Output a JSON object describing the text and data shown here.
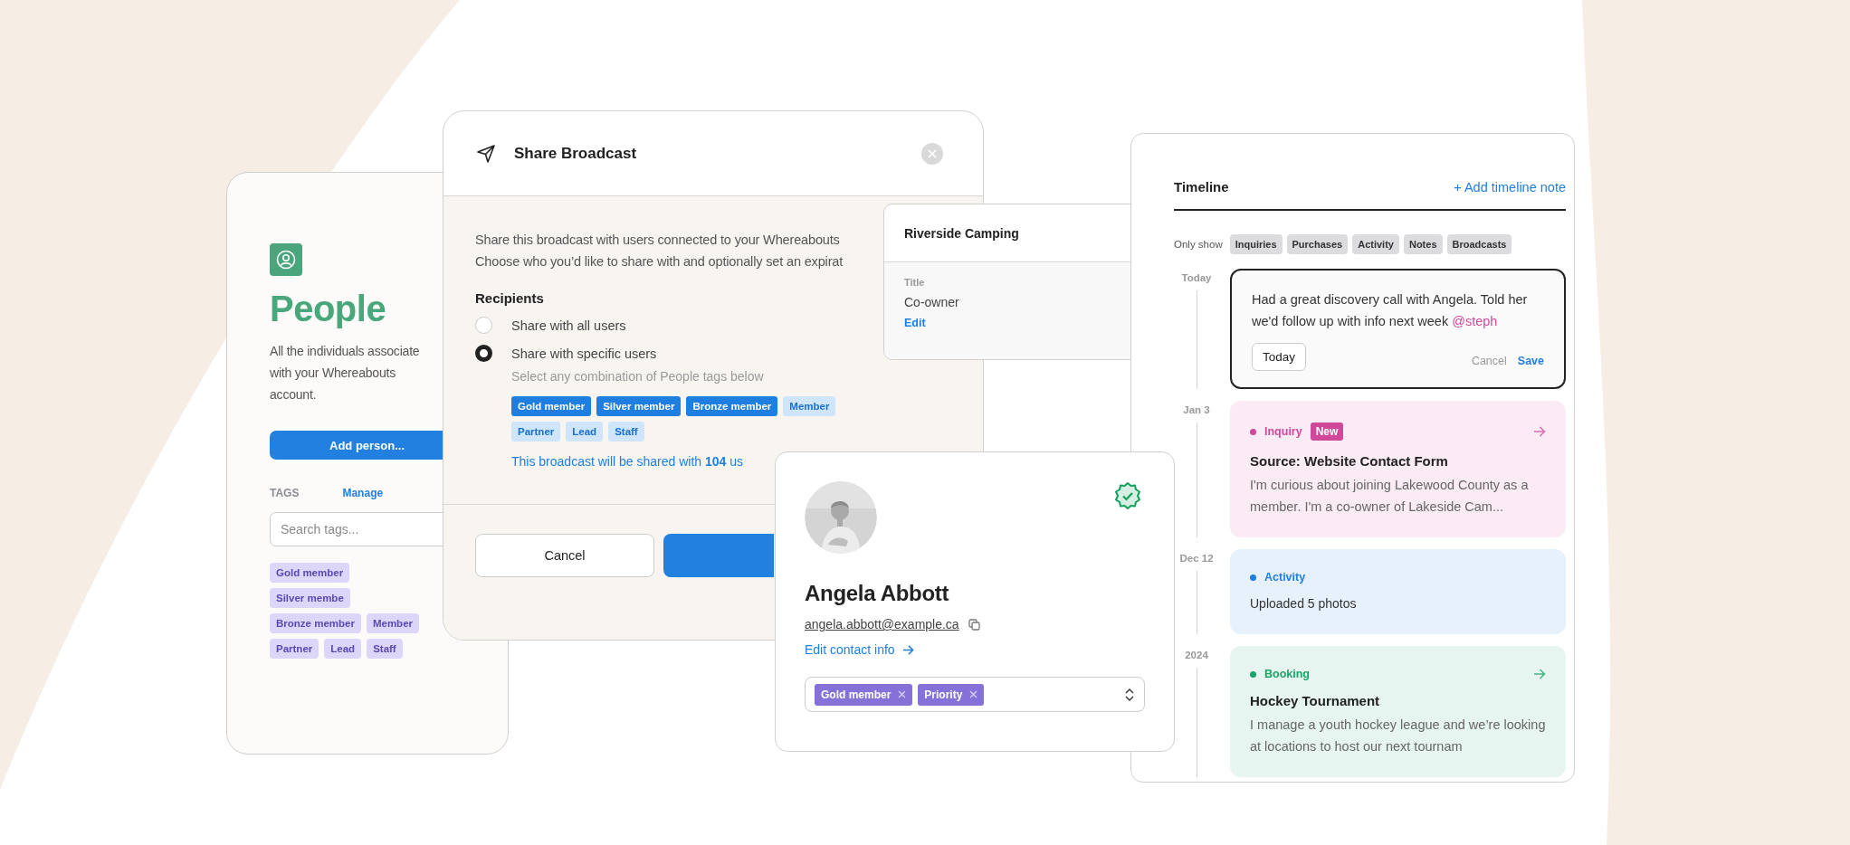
{
  "people_card": {
    "title": "People",
    "description_lines": [
      "All the individuals associate",
      "with your Whereabouts",
      "account."
    ],
    "add_button": "Add person...",
    "tags_label": "TAGS",
    "manage_link": "Manage",
    "search": {
      "placeholder": "Search tags..."
    },
    "tags": [
      "Gold member",
      "Silver membe",
      "Bronze member",
      "Member",
      "Partner",
      "Lead",
      "Staff"
    ]
  },
  "share_dialog": {
    "title": "Share Broadcast",
    "description_lines": [
      "Share this broadcast with users connected to your Whereabouts",
      "Choose who you’d like to share with and optionally set an expirat"
    ],
    "recipients_label": "Recipients",
    "options": [
      {
        "label": "Share with all users",
        "selected": false
      },
      {
        "label": "Share with specific users",
        "selected": true
      }
    ],
    "hint": "Select any combination of People tags below",
    "tags": [
      {
        "label": "Gold member",
        "selected": true
      },
      {
        "label": "Silver member",
        "selected": true
      },
      {
        "label": "Bronze member",
        "selected": true
      },
      {
        "label": "Member",
        "selected": false
      },
      {
        "label": "Partner",
        "selected": false
      },
      {
        "label": "Lead",
        "selected": false
      },
      {
        "label": "Staff",
        "selected": false
      }
    ],
    "summary": "This broadcast will be shared with **104** us",
    "cancel_button": "Cancel"
  },
  "contact_card": {
    "company": "Riverside Camping",
    "field_label": "Title",
    "field_value": "Co-owner",
    "edit_link": "Edit"
  },
  "profile_card": {
    "kind": "picture",
    "verified": true,
    "name": "Angela Abbott",
    "email": "angela.abbott@example.ca",
    "edit_link": "Edit contact info",
    "tags": [
      "Gold member",
      "Priority"
    ]
  },
  "timeline": {
    "title": "Timeline",
    "add_link": "+ Add timeline note",
    "filter_label": "Only show",
    "filters": [
      "Inquiries",
      "Purchases",
      "Activity",
      "Notes",
      "Broadcasts"
    ],
    "note": {
      "date": "Today",
      "text": "Had a great discovery call with Angela. Told her we'd follow up with info next week",
      "mention": "@steph",
      "date_button": "Today",
      "cancel": "Cancel",
      "save": "Save"
    },
    "entries": [
      {
        "date": "Jan 3",
        "type_label": "Inquiry",
        "color": "#d0489a",
        "badge": "New",
        "link": true,
        "title": "Source: Website Contact Form",
        "text": "I'm curious about joining Lakewood County as a member. I'm a co-owner of Lakeside Cam..."
      },
      {
        "date": "Dec 12",
        "type_label": "Activity",
        "color": "#1f7fe0",
        "link": false,
        "text": "Uploaded 5 photos"
      },
      {
        "date": "2024",
        "type_label": "Booking",
        "color": "#19a56a",
        "link": true,
        "title": "Hockey Tournament",
        "text": "I manage a youth hockey league and we’re looking at locations to host our next tournam"
      }
    ]
  }
}
